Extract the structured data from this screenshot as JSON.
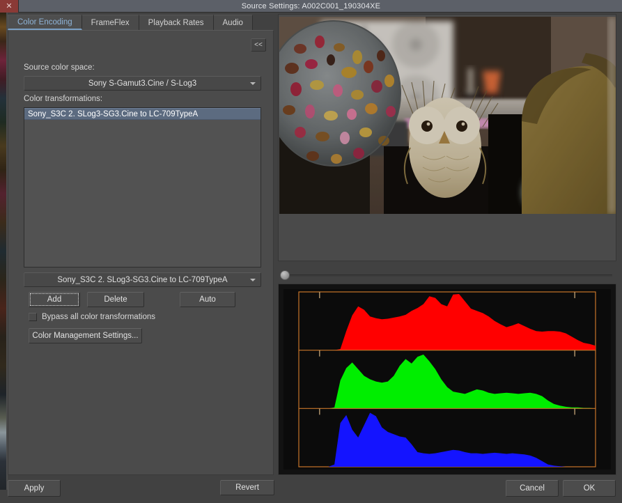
{
  "window": {
    "title": "Source Settings: A002C001_190304XE",
    "close_glyph": "✕"
  },
  "tabs": [
    {
      "label": "Color Encoding",
      "active": true
    },
    {
      "label": "FrameFlex",
      "active": false
    },
    {
      "label": "Playback Rates",
      "active": false
    },
    {
      "label": "Audio",
      "active": false
    }
  ],
  "panel": {
    "collapse_label": "<<",
    "source_color_space_label": "Source color space:",
    "source_color_space_value": "Sony S-Gamut3.Cine / S-Log3",
    "color_transformations_label": "Color transformations:",
    "transform_list": [
      {
        "label": "Sony_S3C 2. SLog3-SG3.Cine to LC-709TypeA",
        "selected": true
      }
    ],
    "transform_combo_value": "Sony_S3C 2. SLog3-SG3.Cine to LC-709TypeA",
    "add_label": "Add",
    "delete_label": "Delete",
    "auto_label": "Auto",
    "bypass_label": "Bypass all color transformations",
    "bypass_checked": false,
    "color_management_label": "Color Management Settings...",
    "revert_label": "Revert"
  },
  "footer": {
    "apply_label": "Apply",
    "cancel_label": "Cancel",
    "ok_label": "OK"
  },
  "colors": {
    "accent_tab": "#8fb4d8",
    "selection": "#5c6b80",
    "scope_frame": "#c8762a",
    "red": "#ff0000",
    "green": "#00ee00",
    "blue": "#1414ff",
    "close_button": "#8a3a36"
  },
  "chart_data": {
    "type": "area",
    "title": "RGB Parade / Waveform histogram",
    "xlabel": "",
    "ylabel": "",
    "grid": false,
    "legend": "none",
    "axis_frame_color": "#c8762a",
    "background": "#0b0b0b",
    "x": [
      0,
      2,
      4,
      6,
      8,
      10,
      12,
      14,
      16,
      18,
      20,
      22,
      24,
      26,
      28,
      30,
      32,
      34,
      36,
      38,
      40,
      42,
      44,
      46,
      48,
      50,
      52,
      54,
      56,
      58,
      60,
      62,
      64,
      66,
      68,
      70,
      72,
      74,
      76,
      78,
      80,
      82,
      84,
      86,
      88,
      90,
      92,
      94,
      96,
      98,
      100
    ],
    "tick_positions_pct": [
      7,
      93
    ],
    "series": [
      {
        "name": "Red",
        "color": "#ff0000",
        "panel": 1,
        "values": [
          0,
          0,
          0,
          0,
          0,
          0,
          0,
          2,
          34,
          62,
          78,
          72,
          60,
          57,
          55,
          56,
          58,
          60,
          63,
          70,
          75,
          82,
          96,
          93,
          82,
          78,
          99,
          100,
          87,
          74,
          70,
          66,
          60,
          52,
          46,
          41,
          44,
          48,
          43,
          38,
          34,
          33,
          34,
          34,
          33,
          30,
          24,
          18,
          13,
          11,
          8
        ]
      },
      {
        "name": "Green",
        "color": "#00ee00",
        "panel": 2,
        "values": [
          0,
          0,
          0,
          0,
          0,
          0,
          2,
          50,
          72,
          82,
          70,
          58,
          52,
          48,
          46,
          48,
          58,
          76,
          88,
          80,
          92,
          96,
          84,
          70,
          52,
          38,
          30,
          28,
          26,
          30,
          34,
          32,
          28,
          26,
          27,
          28,
          27,
          26,
          27,
          28,
          26,
          22,
          14,
          8,
          5,
          3,
          2,
          2,
          1,
          1,
          0
        ]
      },
      {
        "name": "Blue",
        "color": "#1414ff",
        "panel": 3,
        "values": [
          0,
          0,
          0,
          0,
          0,
          0,
          4,
          78,
          92,
          66,
          52,
          74,
          96,
          90,
          70,
          62,
          58,
          54,
          52,
          40,
          26,
          24,
          23,
          24,
          26,
          28,
          30,
          29,
          26,
          24,
          24,
          23,
          24,
          25,
          24,
          23,
          24,
          23,
          22,
          20,
          16,
          10,
          4,
          2,
          1,
          0,
          0,
          0,
          0,
          0,
          0
        ]
      }
    ]
  },
  "preview": {
    "description": "still-life video frame",
    "scrub_position_pct": 0
  }
}
